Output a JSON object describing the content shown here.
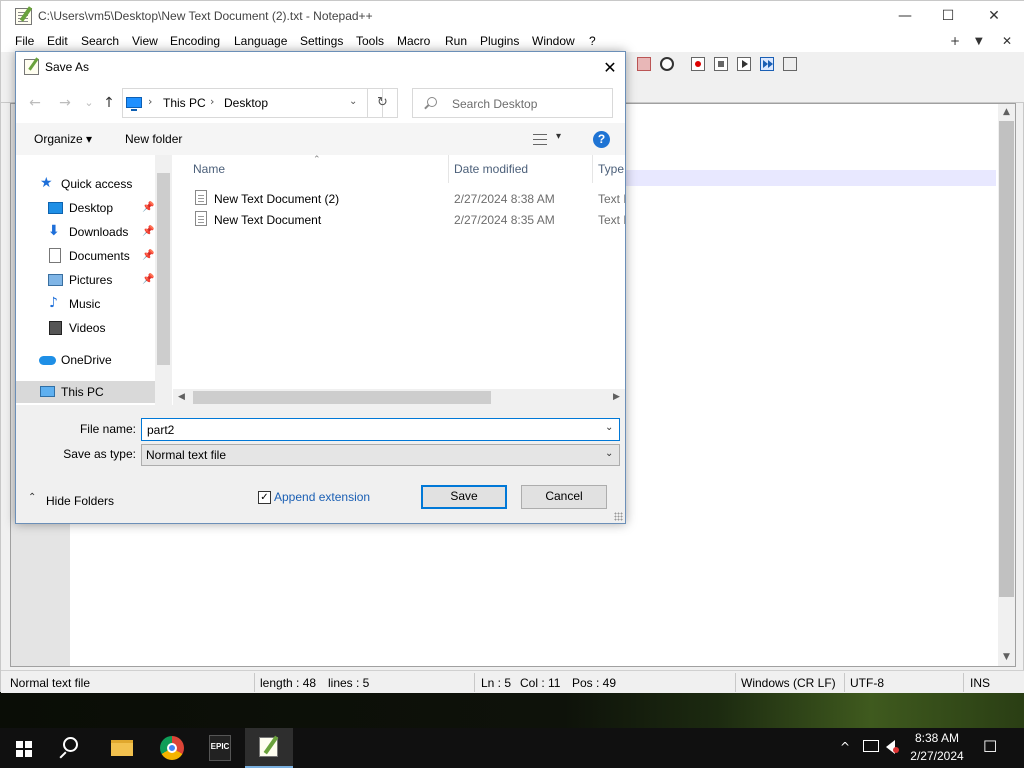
{
  "notepad": {
    "title": "C:\\Users\\vm5\\Desktop\\New Text Document (2).txt - Notepad++",
    "window_controls": {
      "minimize": "—",
      "maximize": "☐",
      "close": "✕"
    },
    "menu": [
      "File",
      "Edit",
      "Search",
      "View",
      "Encoding",
      "Language",
      "Settings",
      "Tools",
      "Macro",
      "Run",
      "Plugins",
      "Window",
      "?"
    ],
    "menu_right": {
      "plus": "+",
      "down": "▼",
      "close": "✕"
    },
    "statusbar": {
      "filetype": "Normal text file",
      "length": "length : 48",
      "lines": "lines : 5",
      "ln": "Ln : 5",
      "col": "Col : 11",
      "pos": "Pos : 49",
      "eol": "Windows (CR LF)",
      "encoding": "UTF-8",
      "mode": "INS"
    }
  },
  "dialog": {
    "title": "Save As",
    "close": "✕",
    "nav": {
      "back": "←",
      "forward": "→",
      "recent": "⌄",
      "up": "↑"
    },
    "address": {
      "crumbs": [
        "This PC",
        "Desktop"
      ],
      "sep": "›",
      "dropdown": "⌄",
      "refresh": "↻"
    },
    "search": {
      "placeholder": "Search Desktop"
    },
    "commands": {
      "organize": "Organize ▾",
      "new_folder": "New folder",
      "view_dropdown": "▾",
      "help": "?"
    },
    "nav_pane": [
      {
        "label": "Quick access",
        "icon": "star-icon",
        "pinned": false
      },
      {
        "label": "Desktop",
        "icon": "desktop-folder-icon",
        "pinned": true
      },
      {
        "label": "Downloads",
        "icon": "download-icon",
        "pinned": true
      },
      {
        "label": "Documents",
        "icon": "documents-icon",
        "pinned": true
      },
      {
        "label": "Pictures",
        "icon": "pictures-icon",
        "pinned": true
      },
      {
        "label": "Music",
        "icon": "music-icon",
        "pinned": false
      },
      {
        "label": "Videos",
        "icon": "videos-icon",
        "pinned": false
      },
      {
        "label": "OneDrive",
        "icon": "cloud-icon",
        "pinned": false
      },
      {
        "label": "This PC",
        "icon": "pc-icon",
        "pinned": false,
        "selected": true
      }
    ],
    "columns": [
      "Name",
      "Date modified",
      "Type"
    ],
    "files": [
      {
        "name": "New Text Document (2)",
        "date": "2/27/2024 8:38 AM",
        "type": "Text D"
      },
      {
        "name": "New Text Document",
        "date": "2/27/2024 8:35 AM",
        "type": "Text D"
      }
    ],
    "form": {
      "filename_label": "File name:",
      "filename_value": "part2",
      "savetype_label": "Save as type:",
      "savetype_value": "Normal text file",
      "hide_folders": "Hide Folders",
      "append_extension": "Append extension",
      "append_checked": true,
      "save": "Save",
      "cancel": "Cancel"
    }
  },
  "taskbar": {
    "apps": [
      "start",
      "search",
      "file-explorer",
      "chrome",
      "epic-games",
      "notepad-plus-plus"
    ],
    "epic_label": "EPIC",
    "time": "8:38 AM",
    "date": "2/27/2024",
    "tray": {
      "chevron": "^",
      "notification": "☐"
    }
  },
  "colors": {
    "accent": "#0078d7",
    "link_blue": "#1a5fb4",
    "taskbar": "#101010"
  }
}
